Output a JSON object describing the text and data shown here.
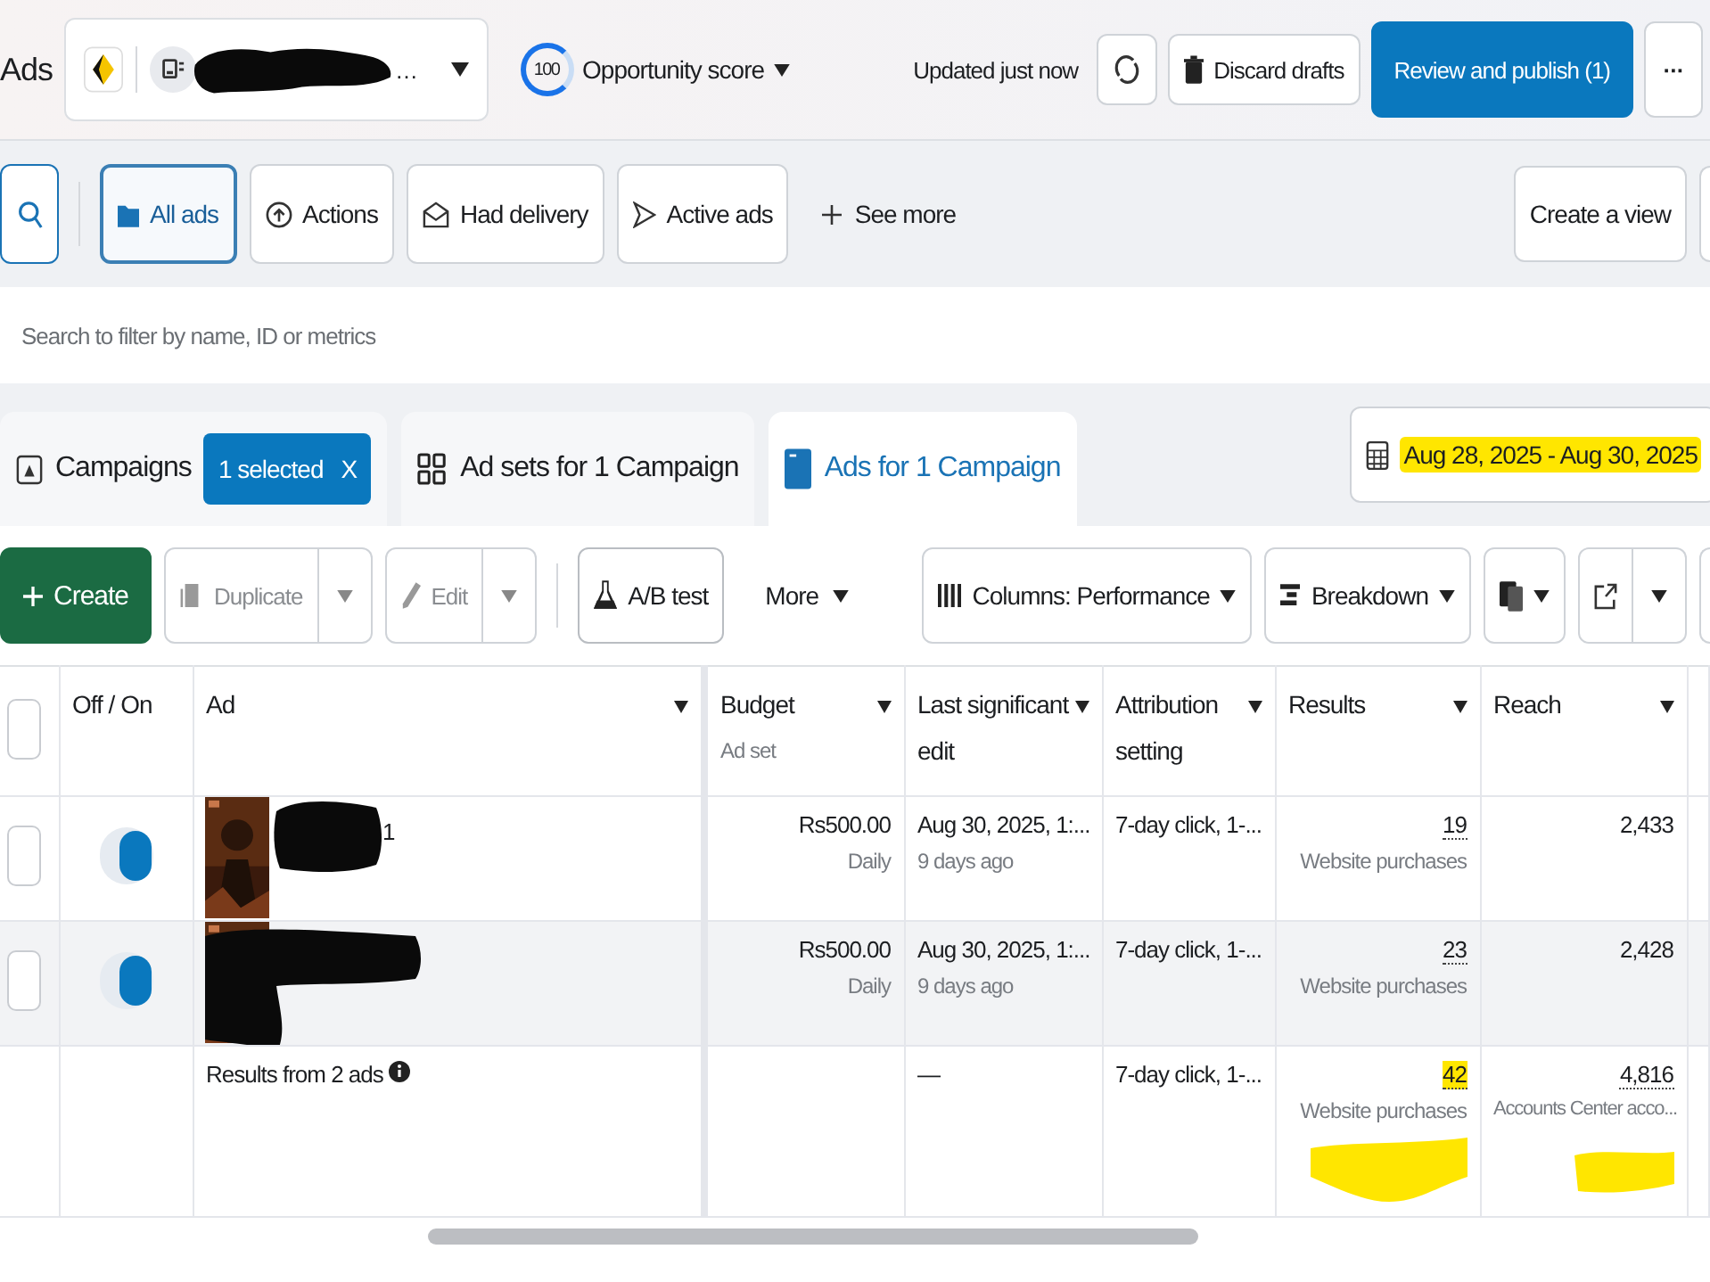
{
  "header": {
    "title": "Ads",
    "account": {
      "suffix": "…",
      "redacted": true
    },
    "opportunity": {
      "score": "100",
      "label": "Opportunity score"
    },
    "status": "Updated just now",
    "discard": "Discard drafts",
    "publish": "Review and publish (1)",
    "more": "···"
  },
  "filters": [
    {
      "label": "All ads",
      "selected": true
    },
    {
      "label": "Actions",
      "selected": false
    },
    {
      "label": "Had delivery",
      "selected": false
    },
    {
      "label": "Active ads",
      "selected": false
    }
  ],
  "see_more": "See more",
  "create_view": "Create a view",
  "search": {
    "placeholder": "Search to filter by name, ID or metrics"
  },
  "tabs": [
    {
      "label": "Campaigns",
      "badge": "1 selected",
      "badge_close": "X",
      "selected": false
    },
    {
      "label": "Ad sets for 1 Campaign",
      "selected": false
    },
    {
      "label": "Ads for 1 Campaign",
      "selected": true
    }
  ],
  "date_range": {
    "label": "Aug 28, 2025 - Aug 30, 2025",
    "highlighted": true
  },
  "toolbar": {
    "create": "Create",
    "duplicate": {
      "label": "Duplicate",
      "disabled": true
    },
    "edit": {
      "label": "Edit",
      "disabled": true
    },
    "ab_test": "A/B test",
    "more": "More",
    "columns": "Columns: Performance",
    "breakdown": "Breakdown"
  },
  "table": {
    "select_all_checked": false,
    "columns": [
      {
        "label": "Off / On",
        "dropdown": false
      },
      {
        "label": "Ad",
        "dropdown": true
      },
      {
        "label": "Budget",
        "sublabel": "Ad set",
        "dropdown": true
      },
      {
        "label": "Last significant edit",
        "dropdown": true
      },
      {
        "label": "Attribution setting",
        "dropdown": true
      },
      {
        "label": "Results",
        "dropdown": true
      },
      {
        "label": "Reach",
        "dropdown": true
      }
    ],
    "rows": [
      {
        "checked": false,
        "on": true,
        "hovered": false,
        "redacted": true,
        "ad_name": "1",
        "budget": "Rs500.00",
        "budget_period": "Daily",
        "last_edit": "Aug 30, 2025, 1:...",
        "last_edit_ago": "9 days ago",
        "attribution": "7-day click, 1-...",
        "results": "19",
        "results_type": "Website purchases",
        "reach": "2,433"
      },
      {
        "checked": false,
        "on": true,
        "hovered": true,
        "redacted": true,
        "budget": "Rs500.00",
        "budget_period": "Daily",
        "last_edit": "Aug 30, 2025, 1:...",
        "last_edit_ago": "9 days ago",
        "attribution": "7-day click, 1-...",
        "results": "23",
        "results_type": "Website purchases",
        "reach": "2,428"
      }
    ],
    "total": {
      "label": "Results from 2 ads",
      "last_edit": "—",
      "attribution": "7-day click, 1-...",
      "results": "42",
      "results_highlighted": true,
      "results_type": "Website purchases",
      "results_scribble": true,
      "reach": "4,816",
      "reach_type": "Accounts Center acco...",
      "reach_scribble": true
    }
  }
}
